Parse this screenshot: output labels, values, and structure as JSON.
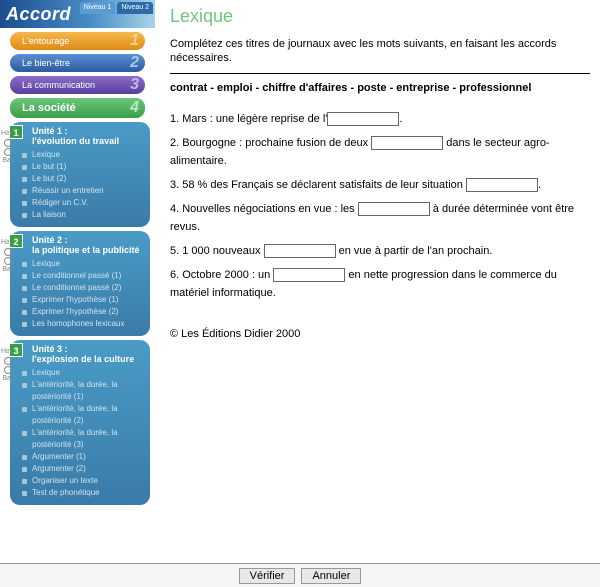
{
  "brand": "Accord",
  "levels": {
    "l1": "Niveau 1",
    "l2": "Niveau 2"
  },
  "nav": {
    "t1": {
      "label": "L'entourage",
      "num": "1"
    },
    "t2": {
      "label": "Le bien-être",
      "num": "2"
    },
    "t3": {
      "label": "La communication",
      "num": "3"
    },
    "t4": {
      "label": "La société",
      "num": "4"
    }
  },
  "hautbas": {
    "haut": "Haut",
    "bas": "Bas"
  },
  "units": [
    {
      "badge": "1",
      "title_a": "Unité 1 :",
      "title_b": "l'évolution du travail",
      "items": [
        "Lexique",
        "Le but (1)",
        "Le but (2)",
        "Réussir un entretien",
        "Rédiger un C.V.",
        "La liaison"
      ]
    },
    {
      "badge": "2",
      "title_a": "Unité 2 :",
      "title_b": "la politique et la publicité",
      "items": [
        "Lexique",
        "Le conditionnel passé (1)",
        "Le conditionnel passé (2)",
        "Exprimer l'hypothèse (1)",
        "Exprimer l'hypothèse (2)",
        "Les homophones lexicaux"
      ]
    },
    {
      "badge": "3",
      "title_a": "Unité 3 :",
      "title_b": "l'explosion de la culture",
      "items": [
        "Lexique",
        "L'antériorité, la durée, la postériorité (1)",
        "L'antériorité, la durée, la postériorité (2)",
        "L'antériorité, la durée, la postériorité (3)",
        "Argumenter (1)",
        "Argumenter (2)",
        "Organiser un texte",
        "Test de phonétique"
      ]
    }
  ],
  "main": {
    "title": "Lexique",
    "instructions": "Complétez ces titres de journaux avec les mots suivants, en faisant les accords nécessaires.",
    "wordlist": "contrat - emploi - chiffre d'affaires - poste - entreprise - professionnel",
    "questions": [
      {
        "pre": "1. Mars : une légère reprise de l'",
        "post": "."
      },
      {
        "pre": "2. Bourgogne : prochaine fusion de deux ",
        "post": " dans le secteur agro-alimentaire."
      },
      {
        "pre": "3. 58 % des Français se déclarent satisfaits de leur situation ",
        "post": "."
      },
      {
        "pre": "4. Nouvelles négociations en vue : les ",
        "post": " à durée déterminée vont être revus."
      },
      {
        "pre": "5. 1 000 nouveaux ",
        "post": " en vue à partir de l'an prochain."
      },
      {
        "pre": "6. Octobre 2000 : un ",
        "post": " en nette progression dans le commerce du matériel informatique."
      }
    ],
    "copyright": "© Les Éditions Didier 2000"
  },
  "footer": {
    "verify": "Vérifier",
    "cancel": "Annuler"
  }
}
